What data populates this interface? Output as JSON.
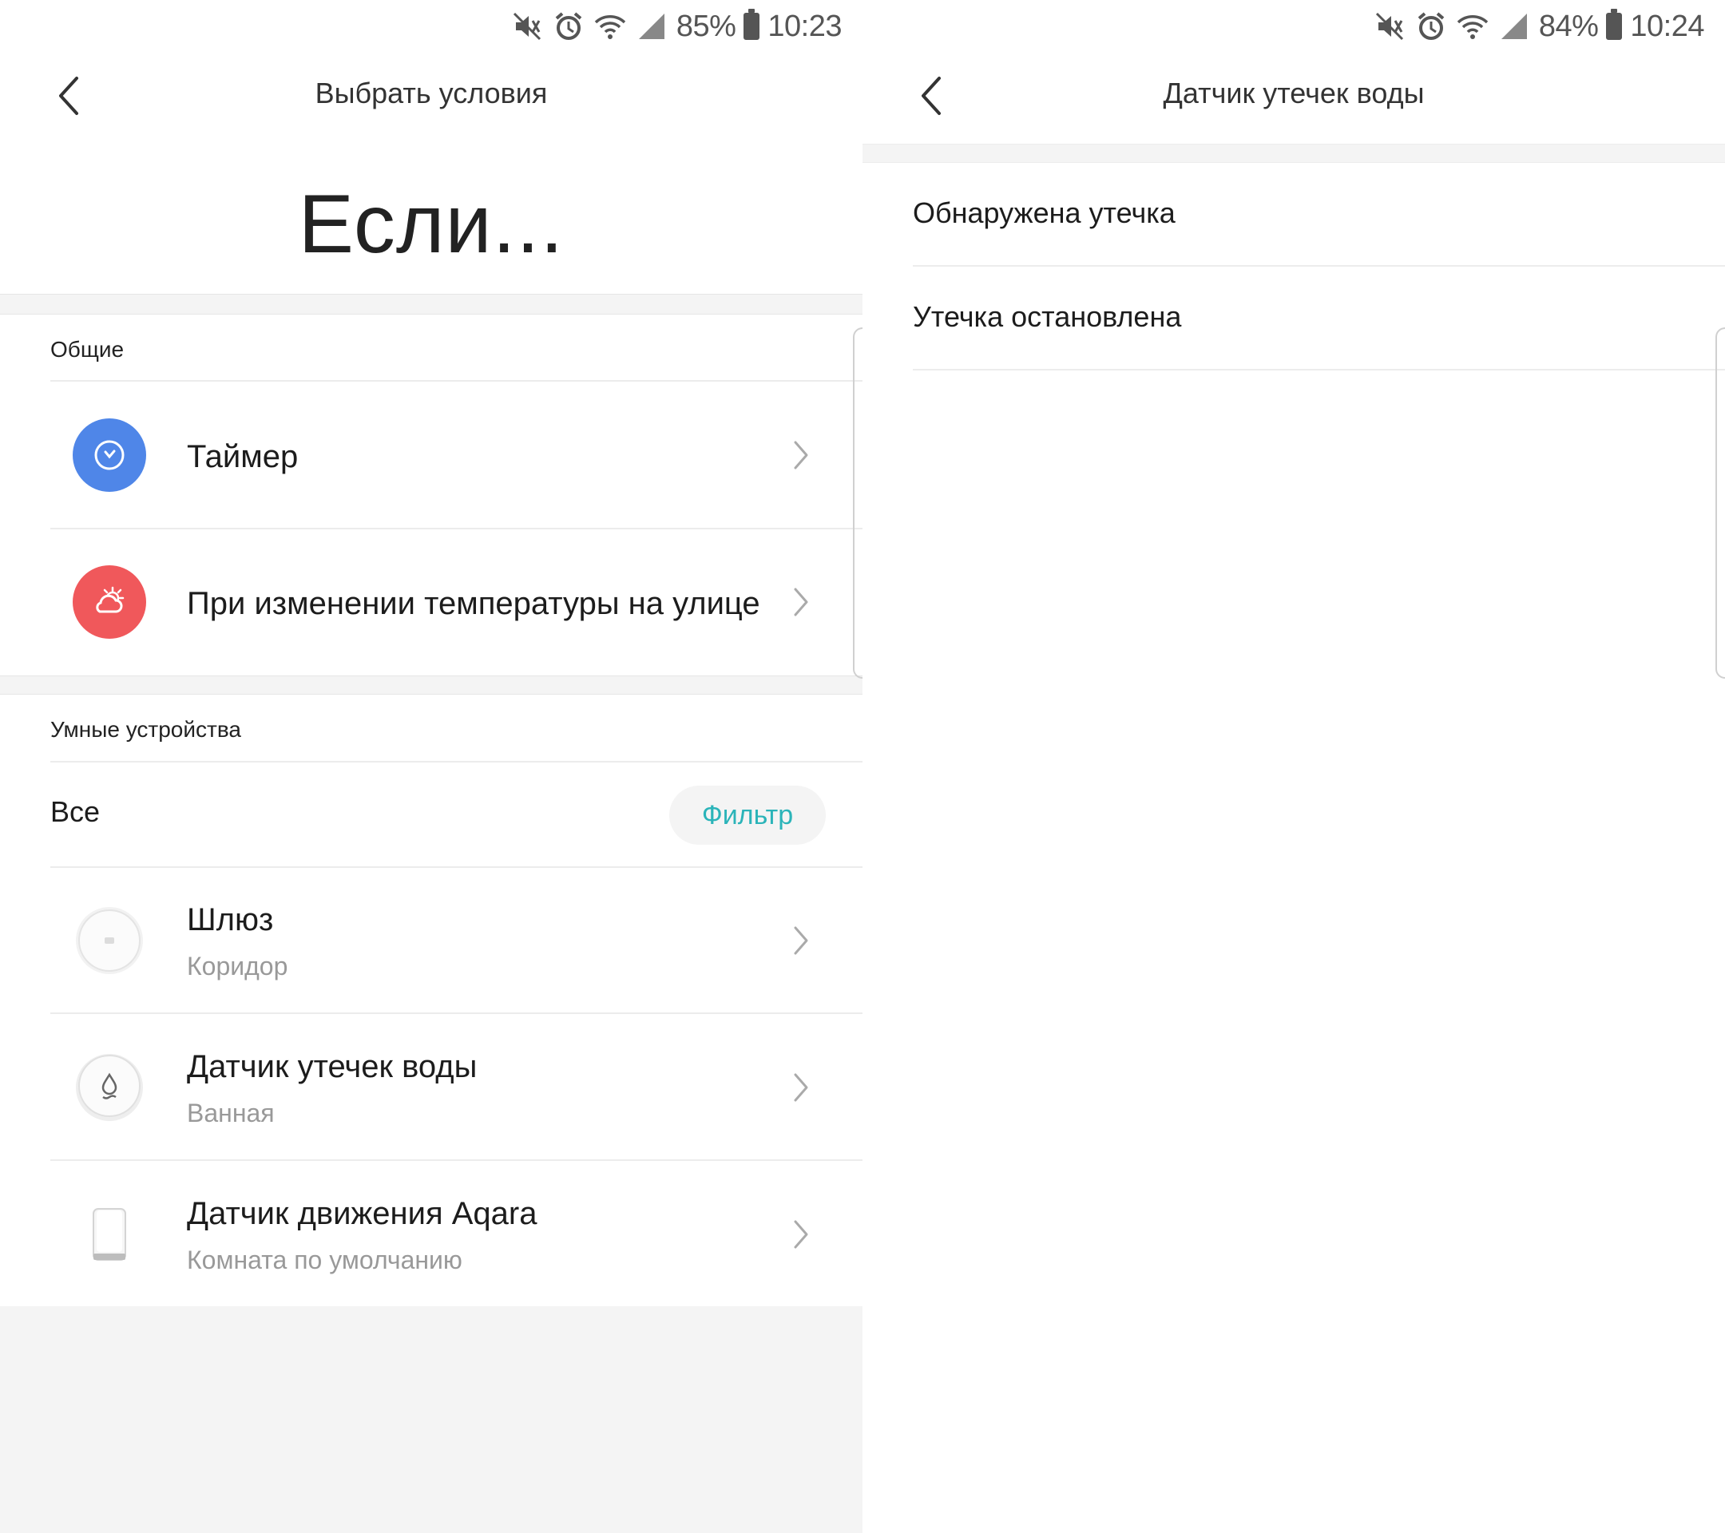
{
  "left": {
    "status": {
      "battery": "85%",
      "time": "10:23"
    },
    "nav": {
      "title": "Выбрать условия"
    },
    "hero": "Если...",
    "general": {
      "header": "Общие",
      "items": [
        {
          "label": "Таймер",
          "icon": "clock-icon",
          "color": "#4f86e8"
        },
        {
          "label": "При изменении температуры на улице",
          "icon": "weather-icon",
          "color": "#f0585b"
        }
      ]
    },
    "smart": {
      "header": "Умные устройства",
      "filter_label": "Все",
      "filter_button": "Фильтр",
      "devices": [
        {
          "name": "Шлюз",
          "room": "Коридор",
          "icon": "gateway-icon"
        },
        {
          "name": "Датчик утечек воды",
          "room": "Ванная",
          "icon": "water-drop-icon"
        },
        {
          "name": "Датчик движения Aqara",
          "room": "Комната по умолчанию",
          "icon": "motion-sensor-icon"
        }
      ]
    }
  },
  "right": {
    "status": {
      "battery": "84%",
      "time": "10:24"
    },
    "nav": {
      "title": "Датчик утечек воды"
    },
    "options": [
      {
        "label": "Обнаружена утечка"
      },
      {
        "label": "Утечка остановлена"
      }
    ]
  },
  "colors": {
    "accent": "#2bb4b9",
    "timer": "#4f86e8",
    "weather": "#f0585b",
    "band": "#f4f4f4"
  }
}
